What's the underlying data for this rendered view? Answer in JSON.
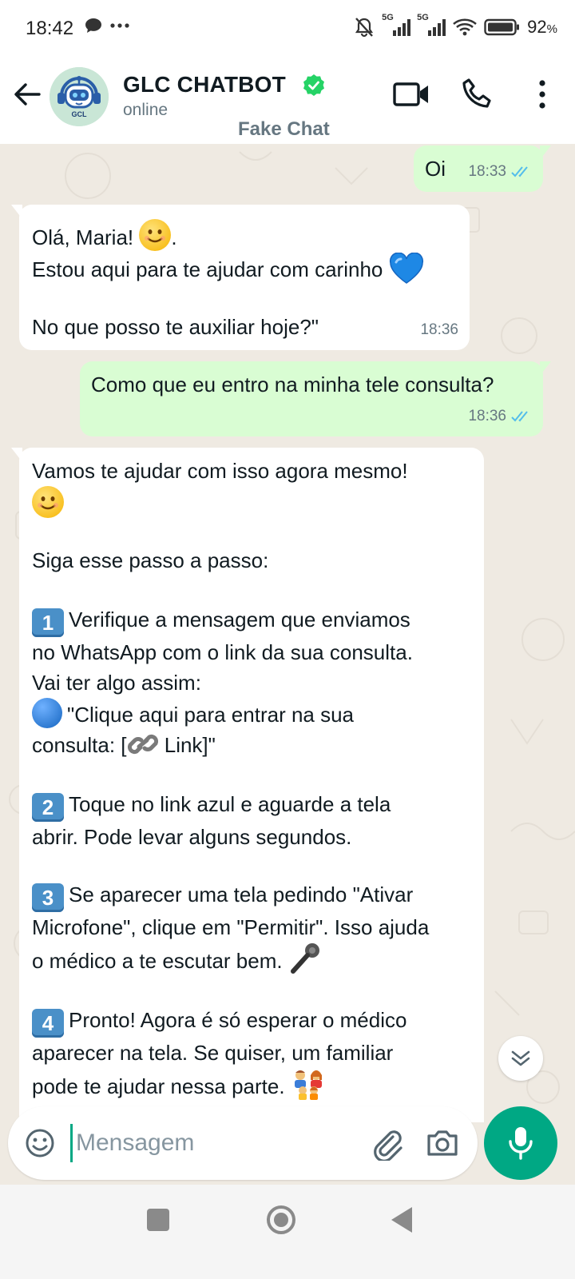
{
  "status_bar": {
    "time": "18:42",
    "net_label_1": "5G",
    "net_label_2": "5G",
    "battery": "92",
    "battery_unit": "%"
  },
  "header": {
    "contact_name": "GLC CHATBOT",
    "status": "online",
    "subtitle": "Fake Chat",
    "avatar_text": "GCL",
    "icons": [
      "back-arrow-icon",
      "verified-badge-icon",
      "video-call-icon",
      "phone-icon",
      "more-vert-icon"
    ]
  },
  "messages": [
    {
      "direction": "out",
      "text": "Oi",
      "time": "18:33",
      "read": true
    },
    {
      "direction": "in",
      "lines": [
        "Olá, Maria!",
        ".",
        "Estou aqui para te ajudar com carinho",
        "No que posso te auxiliar hoje?\""
      ],
      "time": "18:36"
    },
    {
      "direction": "out",
      "text": "Como que eu entro na minha tele consulta?",
      "time": "18:36",
      "read": true
    },
    {
      "direction": "in",
      "intro": "Vamos te ajudar com isso agora mesmo!",
      "steps_title": "Siga esse passo a passo:",
      "steps": [
        {
          "num": "1",
          "lines": [
            "Verifique a mensagem que enviamos",
            "no WhatsApp com o link da sua consulta.",
            "Vai ter algo assim:"
          ],
          "quote_a": "\"Clique aqui para entrar na sua",
          "quote_b_prefix": "consulta: [",
          "quote_b_suffix": " Link]\""
        },
        {
          "num": "2",
          "lines": [
            "Toque no link azul e aguarde a tela",
            "abrir. Pode levar alguns segundos."
          ]
        },
        {
          "num": "3",
          "lines": [
            "Se aparecer uma tela pedindo \"Ativar",
            "Microfone\", clique em \"Permitir\". Isso ajuda",
            "o médico a te escutar bem."
          ]
        },
        {
          "num": "4",
          "lines": [
            "Pronto! Agora é só esperar o médico",
            "aparecer na tela. Se quiser, um familiar",
            "pode te ajudar nessa parte."
          ]
        }
      ]
    }
  ],
  "composer": {
    "placeholder": "Mensagem",
    "value": ""
  },
  "colors": {
    "outgoing_bubble": "#d9fdd3",
    "incoming_bubble": "#ffffff",
    "accent": "#00a884",
    "verified": "#25d366",
    "read_ticks": "#53bdeb",
    "chat_background": "#efeae2"
  }
}
